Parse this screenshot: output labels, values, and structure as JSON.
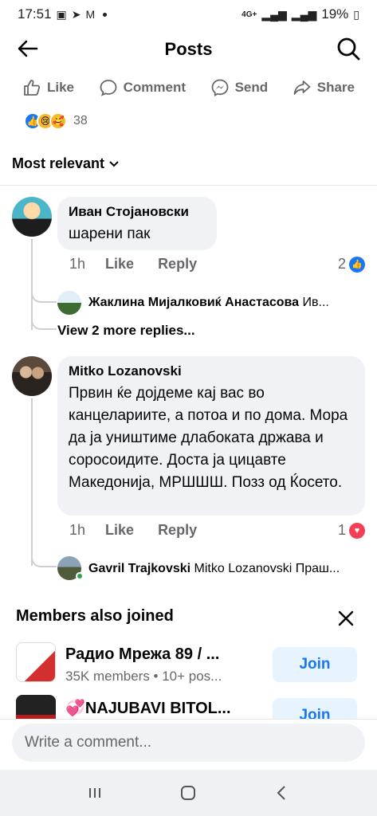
{
  "status": {
    "time": "17:51",
    "network": "4G+",
    "battery": "19%"
  },
  "header": {
    "title": "Posts"
  },
  "actions": {
    "like": "Like",
    "comment": "Comment",
    "send": "Send",
    "share": "Share"
  },
  "reactions": {
    "count": "38"
  },
  "sort": {
    "label": "Most relevant"
  },
  "comments": [
    {
      "author": "Иван Стојановски",
      "text": "шарени пак",
      "time": "1h",
      "like": "Like",
      "reply": "Reply",
      "reaction_count": "2",
      "reply_preview": {
        "author": "Жаклина Мијалковиќ Анастасова",
        "text": "Ив..."
      },
      "more_replies": "View 2 more replies..."
    },
    {
      "author": "Mitko Lozanovski",
      "text": "Првин ќе дојдеме кај вас во канцелариите, а потоа и по дома. Мора да ја уништиме длабоката држава и соросоидите. Доста ја цицавте Македонија, МРШШШ. Позз од Ќосето.",
      "time": "1h",
      "like": "Like",
      "reply": "Reply",
      "reaction_count": "1",
      "reply_preview": {
        "author": "Gavril Trajkovski",
        "text": "Mitko Lozanovski Праш..."
      }
    }
  ],
  "members": {
    "title": "Members also joined",
    "groups": [
      {
        "name": "Радио Мрежа 89 / ...",
        "sub": "35K members • 10+ pos...",
        "join": "Join"
      },
      {
        "name": "💞NAJUBAVI BITOL...",
        "join": "Join"
      }
    ]
  },
  "composer": {
    "placeholder": "Write a comment..."
  }
}
